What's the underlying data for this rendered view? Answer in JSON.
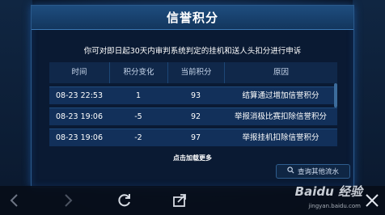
{
  "dialog": {
    "title": "信誉积分",
    "notice": "你可对即日起30天内审判系统判定的挂机和送人头扣分进行申诉"
  },
  "table": {
    "headers": [
      "时间",
      "积分变化",
      "当前积分",
      "原因"
    ],
    "rows": [
      {
        "time": "08-23  22:53",
        "change": "1",
        "current": "93",
        "reason": "结算通过增加信誉积分"
      },
      {
        "time": "08-23  19:06",
        "change": "-5",
        "current": "92",
        "reason": "举报消极比赛扣除信誉积分"
      },
      {
        "time": "08-23  19:06",
        "change": "-2",
        "current": "97",
        "reason": "举报挂机扣除信誉积分"
      }
    ]
  },
  "load_more_label": "点击加载更多",
  "query_other_label": "查询其他流水",
  "watermark": {
    "brand": "Baidu 经验",
    "url": "jingyan.baidu.com"
  },
  "icons": [
    "back-arrow-icon",
    "forward-arrow-icon",
    "refresh-icon",
    "share-icon",
    "close-icon",
    "search-icon"
  ]
}
